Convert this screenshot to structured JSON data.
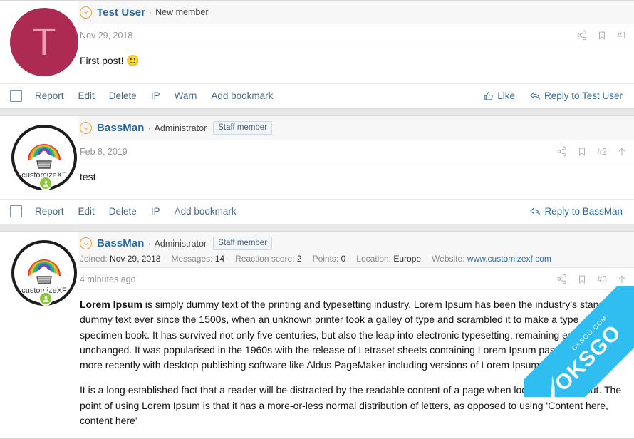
{
  "posts": [
    {
      "author": "Test User",
      "user_title": "New member",
      "staff_badge": null,
      "avatar_type": "letter",
      "avatar_letter": "T",
      "avatar_color": "#ad2b52",
      "avatar_letter_color": "#ef9bb3",
      "online": false,
      "date": "Nov 29, 2018",
      "post_number": "#1",
      "has_scroll_top": false,
      "stats": [],
      "body": [
        {
          "type": "text",
          "runs": [
            {
              "text": "First post! ",
              "bold": false
            },
            {
              "text": "🙂",
              "bold": false,
              "emoji": true
            }
          ]
        }
      ],
      "actions": [
        "Report",
        "Edit",
        "Delete",
        "IP",
        "Warn",
        "Add bookmark"
      ],
      "like_label": "Like",
      "reply_label": "Reply to Test User"
    },
    {
      "author": "BassMan",
      "user_title": "Administrator",
      "staff_badge": "Staff member",
      "avatar_type": "logo",
      "avatar_logo_text": "customizeXF",
      "online": true,
      "date": "Feb 8, 2019",
      "post_number": "#2",
      "has_scroll_top": true,
      "stats": [],
      "body": [
        {
          "type": "text",
          "runs": [
            {
              "text": "test",
              "bold": false
            }
          ]
        }
      ],
      "actions": [
        "Report",
        "Edit",
        "Delete",
        "IP",
        "Add bookmark"
      ],
      "like_label": null,
      "reply_label": "Reply to BassMan"
    },
    {
      "author": "BassMan",
      "user_title": "Administrator",
      "staff_badge": "Staff member",
      "avatar_type": "logo",
      "avatar_logo_text": "customizeXF",
      "online": true,
      "date": "4 minutes ago",
      "post_number": "#3",
      "has_scroll_top": true,
      "stats": [
        {
          "label": "Joined:",
          "value": "Nov 29, 2018",
          "link": false
        },
        {
          "label": "Messages:",
          "value": "14",
          "link": false
        },
        {
          "label": "Reaction score:",
          "value": "2",
          "link": false
        },
        {
          "label": "Points:",
          "value": "0",
          "link": false
        },
        {
          "label": "Location:",
          "value": "Europe",
          "link": false
        },
        {
          "label": "Website:",
          "value": "www.customizexf.com",
          "link": true
        }
      ],
      "body": [
        {
          "type": "text",
          "runs": [
            {
              "text": "Lorem Ipsum",
              "bold": true
            },
            {
              "text": " is simply dummy text of the printing and typesetting industry. Lorem Ipsum has been the industry's standard dummy text ever since the 1500s, when an unknown printer took a galley of type and scrambled it to make a type specimen book. It has survived not only five centuries, but also the leap into electronic typesetting, remaining essentially unchanged. It was popularised in the 1960s with the release of Letraset sheets containing Lorem Ipsum passages, and more recently with desktop publishing software like Aldus PageMaker including versions of Lorem Ipsum.",
              "bold": false
            }
          ]
        },
        {
          "type": "text",
          "runs": [
            {
              "text": "It is a long established fact that a reader will be distracted by the readable content of a page when looking at its layout. The point of using Lorem Ipsum is that it has a more-or-less normal distribution of letters, as opposed to using 'Content here, content here'",
              "bold": false
            }
          ]
        }
      ],
      "actions": [],
      "like_label": null,
      "reply_label": null
    }
  ],
  "icons": {
    "share": "share-icon",
    "bookmark": "bookmark-icon",
    "scroll_top": "arrow-up-icon",
    "like": "thumbs-up-icon",
    "reply": "reply-arrow-icon",
    "chevron_down": "chevron-down-circle-icon"
  },
  "watermark": {
    "text": "OKSGO",
    "subtext": "OKSGO.COM",
    "color": "#2fbeef"
  },
  "separator": "·"
}
